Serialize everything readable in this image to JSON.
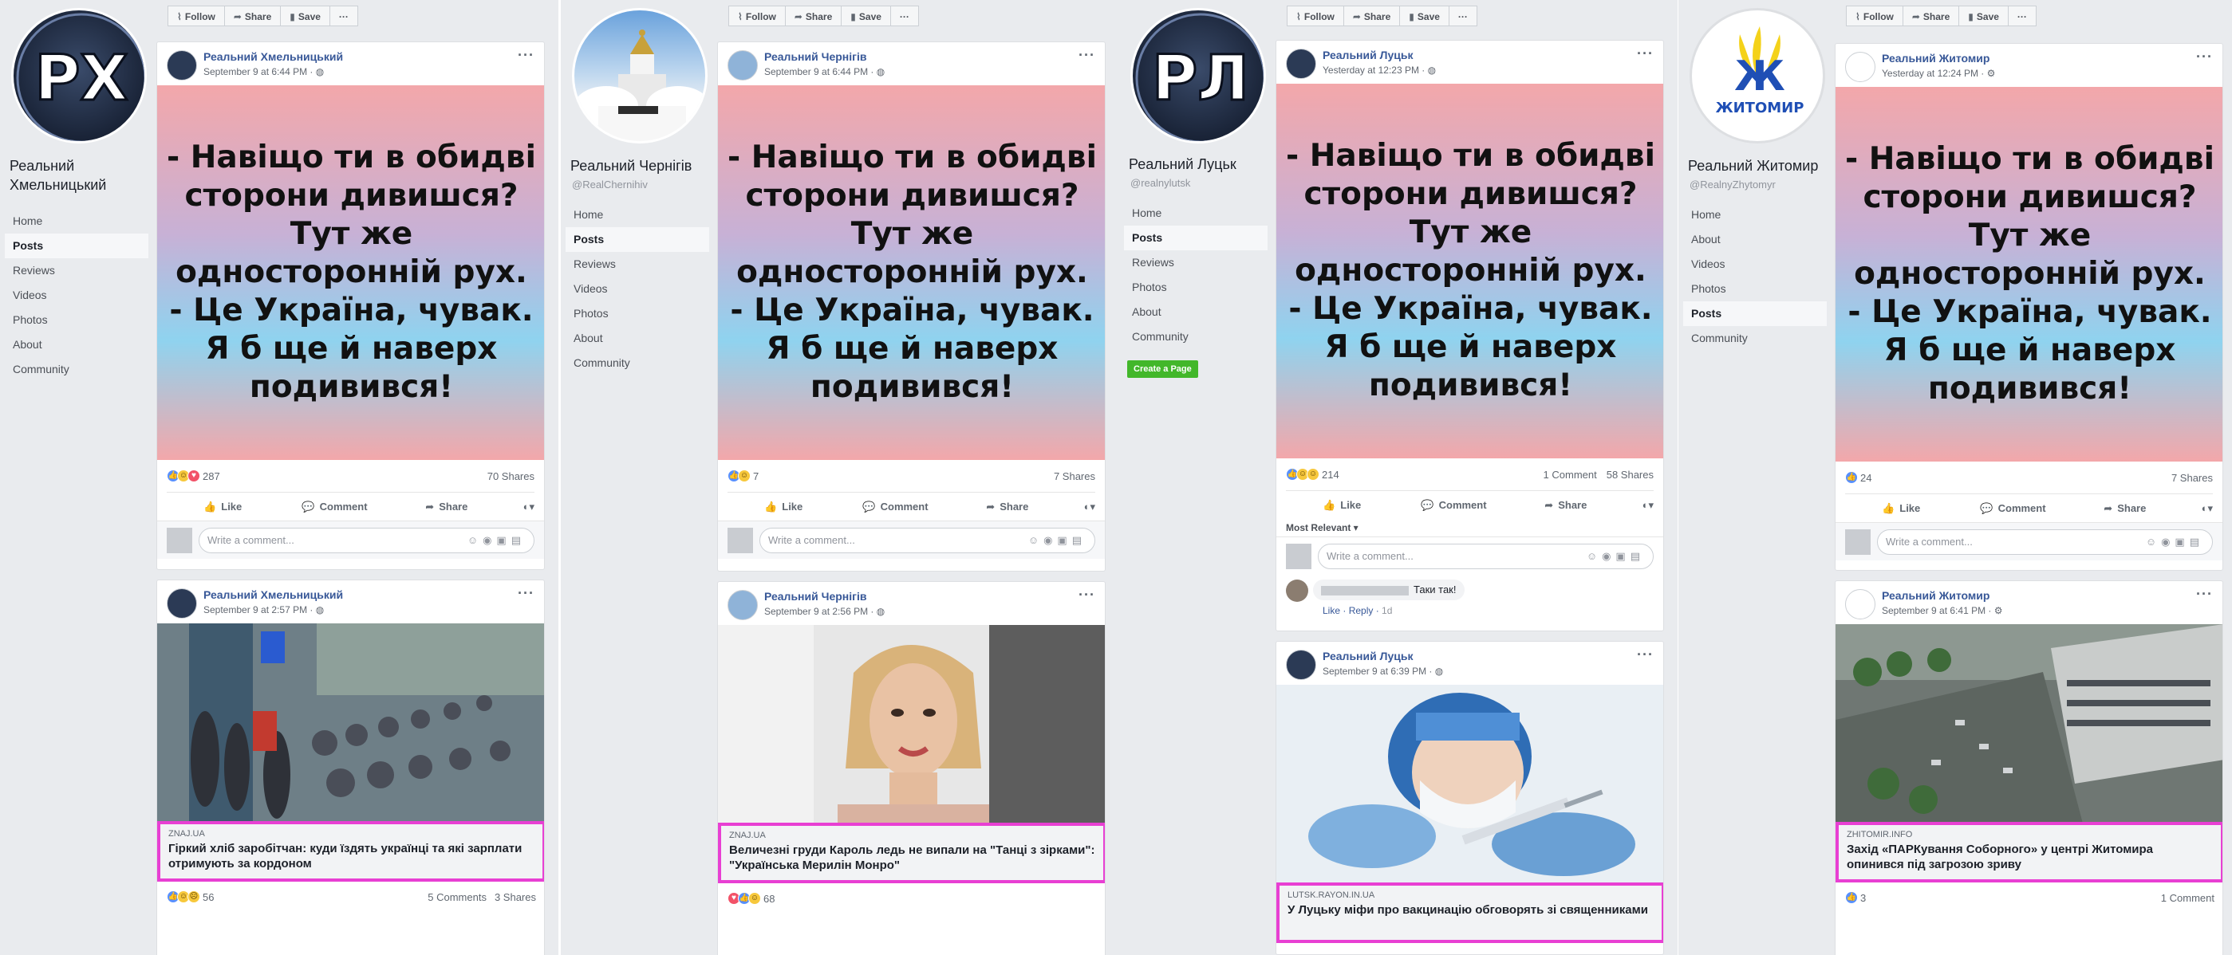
{
  "common": {
    "follow": "Follow",
    "share": "Share",
    "save": "Save",
    "more": "···",
    "like": "Like",
    "comment": "Comment",
    "write_comment": "Write a comment...",
    "most_relevant": "Most Relevant ▾"
  },
  "panels": [
    {
      "page_name": "Реальний Хмельницький",
      "handle": "",
      "nav": [
        "Home",
        "Posts",
        "Reviews",
        "Videos",
        "Photos",
        "About",
        "Community"
      ],
      "active_nav": 1,
      "post1": {
        "author": "Реальний Хмельницький",
        "time": "September 9 at 6:44 PM · ◍",
        "reactions": "287",
        "comments": "",
        "shares": "70 Shares"
      },
      "post2": {
        "author": "Реальний Хмельницький",
        "time": "September 9 at 2:57 PM · ◍",
        "domain": "ZNAJ.UA",
        "title": "Гіркий хліб заробітчан: куди їздять українці та які зарплати отримують за кордоном",
        "reactions": "56",
        "comments": "5 Comments",
        "shares": "3 Shares"
      }
    },
    {
      "page_name": "Реальний Чернігів",
      "handle": "@RealChernihiv",
      "nav": [
        "Home",
        "Posts",
        "Reviews",
        "Videos",
        "Photos",
        "About",
        "Community"
      ],
      "active_nav": 1,
      "post1": {
        "author": "Реальний Чернігів",
        "time": "September 9 at 6:44 PM · ◍",
        "reactions": "7",
        "comments": "",
        "shares": "7 Shares"
      },
      "post2": {
        "author": "Реальний Чернігів",
        "time": "September 9 at 2:56 PM · ◍",
        "domain": "ZNAJ.UA",
        "title": "Величезні груди Кароль ледь не випали на \"Танці з зірками\": \"Українська Мерилін Монро\"",
        "reactions": "68",
        "comments": "",
        "shares": ""
      }
    },
    {
      "page_name": "Реальний Луцьк",
      "handle": "@realnylutsk",
      "nav": [
        "Home",
        "Posts",
        "Reviews",
        "Photos",
        "About",
        "Community"
      ],
      "active_nav": 1,
      "create_page": "Create a Page",
      "post1": {
        "author": "Реальний Луцьк",
        "time": "Yesterday at 12:23 PM · ◍",
        "reactions": "214",
        "comments": "1 Comment",
        "shares": "58 Shares",
        "reply_text": "Таки так!",
        "reply_meta_like": "Like",
        "reply_meta_reply": "Reply",
        "reply_meta_time": "1d"
      },
      "post2": {
        "author": "Реальний Луцьк",
        "time": "September 9 at 6:39 PM · ◍",
        "domain": "LUTSK.RAYON.IN.UA",
        "title": "У Луцьку міфи про вакцинацію обговорять зі священниками"
      }
    },
    {
      "page_name": "Реальний Житомир",
      "handle": "@RealnyZhytomyr",
      "nav": [
        "Home",
        "About",
        "Videos",
        "Photos",
        "Posts",
        "Community"
      ],
      "active_nav": 4,
      "logo_text": "ЖИТОМИР",
      "post1": {
        "author": "Реальний Житомир",
        "time": "Yesterday at 12:24 PM · ⚙",
        "reactions": "24",
        "comments": "",
        "shares": "7 Shares"
      },
      "post2": {
        "author": "Реальний Житомир",
        "time": "September 9 at 6:41 PM · ⚙",
        "domain": "ZHITOMIR.INFO",
        "title": "Захід «ПАРКування Соборного» у центрі Житомира опинився під загрозою зриву",
        "reactions": "3",
        "comments": "1 Comment",
        "shares": ""
      }
    }
  ],
  "meme_text": "- Навіщо ти в обидві\nсторони дивишся?\nТут же\nодносторонній рух.\n- Це Україна, чувак.\nЯ б ще й наверх\nподивився!",
  "avatar_letters": [
    "РХ",
    "",
    "РЛ",
    ""
  ],
  "colors": {
    "highlight": "#e83fd3",
    "link": "#385898",
    "fb_bg": "#e9ebee"
  }
}
